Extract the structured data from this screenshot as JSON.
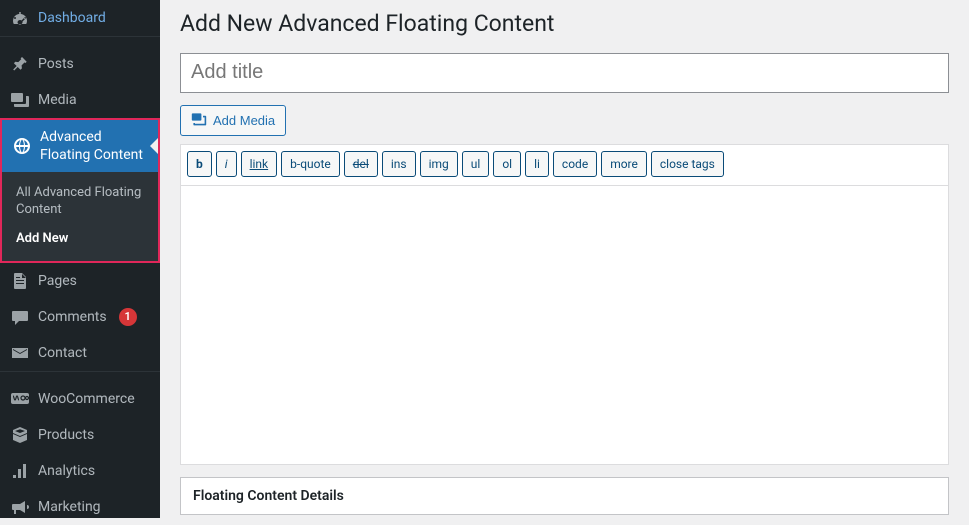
{
  "sidebar": {
    "items": [
      {
        "label": "Dashboard",
        "icon": "dashboard"
      },
      {
        "label": "Posts",
        "icon": "pin"
      },
      {
        "label": "Media",
        "icon": "media"
      },
      {
        "label": "Advanced Floating Content",
        "icon": "globe",
        "active": true
      },
      {
        "label": "Pages",
        "icon": "pages"
      },
      {
        "label": "Comments",
        "icon": "comment",
        "badge": "1"
      },
      {
        "label": "Contact",
        "icon": "mail"
      },
      {
        "label": "WooCommerce",
        "icon": "woo"
      },
      {
        "label": "Products",
        "icon": "box"
      },
      {
        "label": "Analytics",
        "icon": "analytics"
      },
      {
        "label": "Marketing",
        "icon": "megaphone"
      }
    ],
    "submenu": [
      {
        "label": "All Advanced Floating Content"
      },
      {
        "label": "Add New",
        "selected": true
      }
    ]
  },
  "page": {
    "title": "Add New Advanced Floating Content",
    "title_placeholder": "Add title",
    "add_media_label": "Add Media"
  },
  "quicktags": [
    "b",
    "i",
    "link",
    "b-quote",
    "del",
    "ins",
    "img",
    "ul",
    "ol",
    "li",
    "code",
    "more",
    "close tags"
  ],
  "metabox": {
    "title": "Floating Content Details"
  }
}
